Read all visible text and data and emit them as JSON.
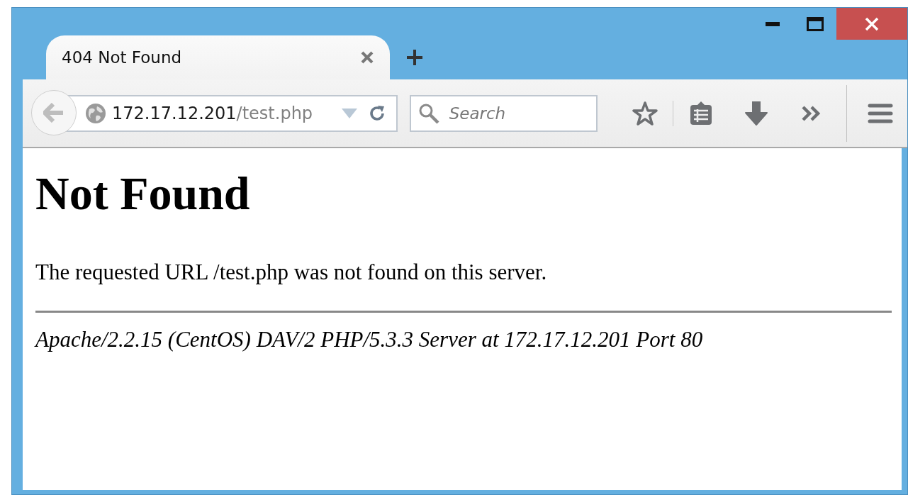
{
  "window": {
    "controls": [
      {
        "kind": "minimize"
      },
      {
        "kind": "maximize"
      },
      {
        "kind": "close"
      }
    ]
  },
  "tabs": [
    {
      "label": "404 Not Found",
      "selected": true
    }
  ],
  "address_bar": {
    "host": "172.17.12.201",
    "path": "/test.php"
  },
  "search": {
    "placeholder": "Search"
  },
  "toolbar": [
    {
      "kind": "bookmark"
    },
    {
      "kind": "divider"
    },
    {
      "kind": "reading-list"
    },
    {
      "kind": "download"
    },
    {
      "kind": "overflow"
    }
  ],
  "page": {
    "heading": "Not Found",
    "message": "The requested URL /test.php was not found on this server.",
    "signature": "Apache/2.2.15 (CentOS) DAV/2 PHP/5.3.3 Server at 172.17.12.201 Port 80"
  }
}
